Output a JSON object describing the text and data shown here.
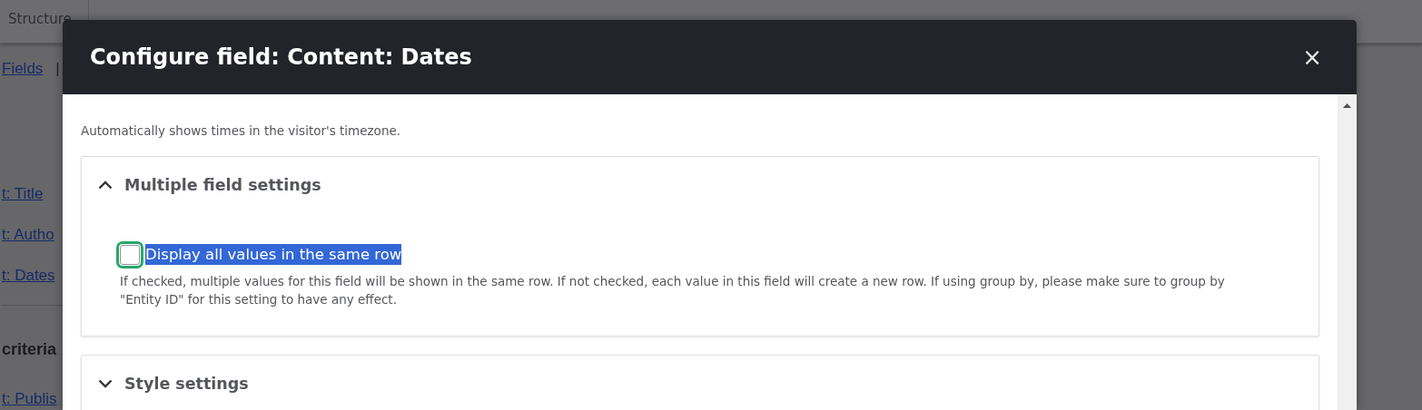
{
  "toolbar": {
    "items": [
      {
        "label": "Structure"
      }
    ]
  },
  "page": {
    "tab_link": "Fields",
    "separator": "|",
    "field_links": [
      "t: Title",
      "t: Autho",
      "t: Dates"
    ],
    "heading": "criteria",
    "criteria_links": [
      "t: Publis"
    ]
  },
  "dialog": {
    "title": "Configure field: Content: Dates",
    "close": "×",
    "option": {
      "description": "Automatically shows times in the visitor's timezone."
    },
    "sections": [
      {
        "title": "Multiple field settings",
        "expanded": true,
        "checkbox": {
          "label": "Display all values in the same row",
          "checked": false,
          "highlighted": true,
          "description": "If checked, multiple values for this field will be shown in the same row. If not checked, each value in this field will create a new row. If using group by, please make sure to group by \"Entity ID\" for this setting to have any effect."
        }
      },
      {
        "title": "Style settings",
        "expanded": false
      }
    ]
  }
}
